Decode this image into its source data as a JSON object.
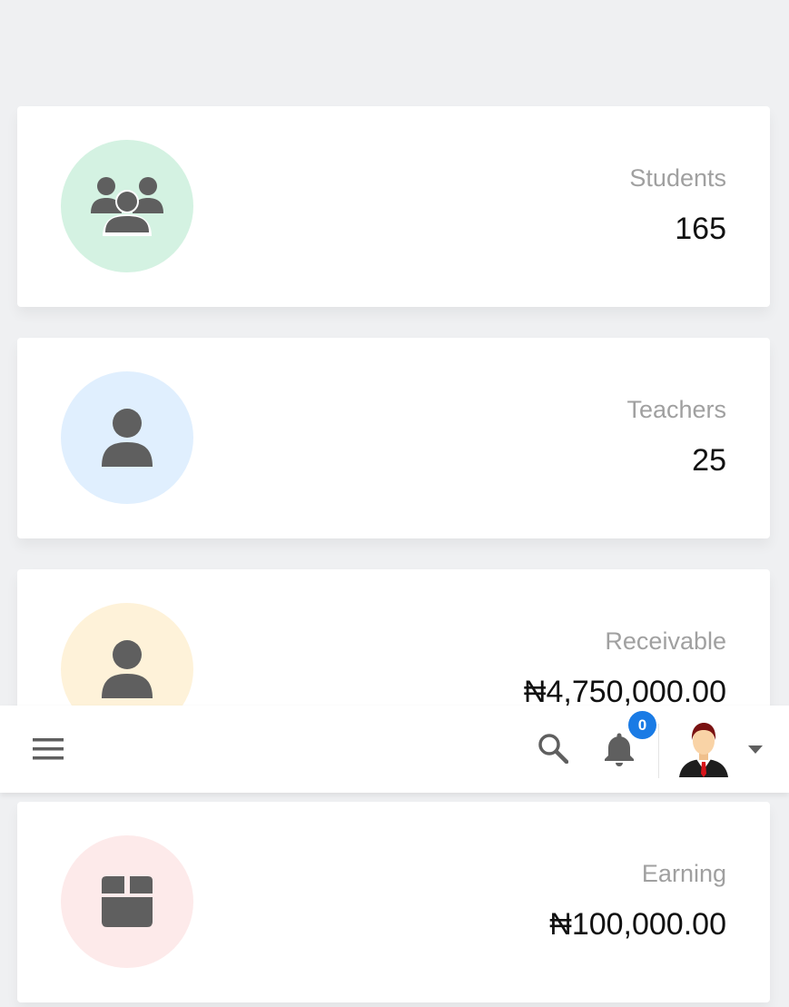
{
  "cards": [
    {
      "label": "Students",
      "value": "165",
      "icon": "users-group-icon",
      "color": "#d4f2e2"
    },
    {
      "label": "Teachers",
      "value": "25",
      "icon": "user-icon",
      "color": "#e0effe"
    },
    {
      "label": "Receivable",
      "value": "₦4,750,000.00",
      "icon": "user-icon",
      "color": "#fef2d9"
    },
    {
      "label": "Earning",
      "value": "₦100,000.00",
      "icon": "box-icon",
      "color": "#fdeaea"
    }
  ],
  "topbar": {
    "menu_icon": "hamburger-menu-icon",
    "search_icon": "search-icon",
    "bell_icon": "bell-icon",
    "notification_count": "0",
    "avatar": "user-avatar",
    "caret_icon": "caret-down-icon",
    "badge_color": "#1a7be5"
  }
}
